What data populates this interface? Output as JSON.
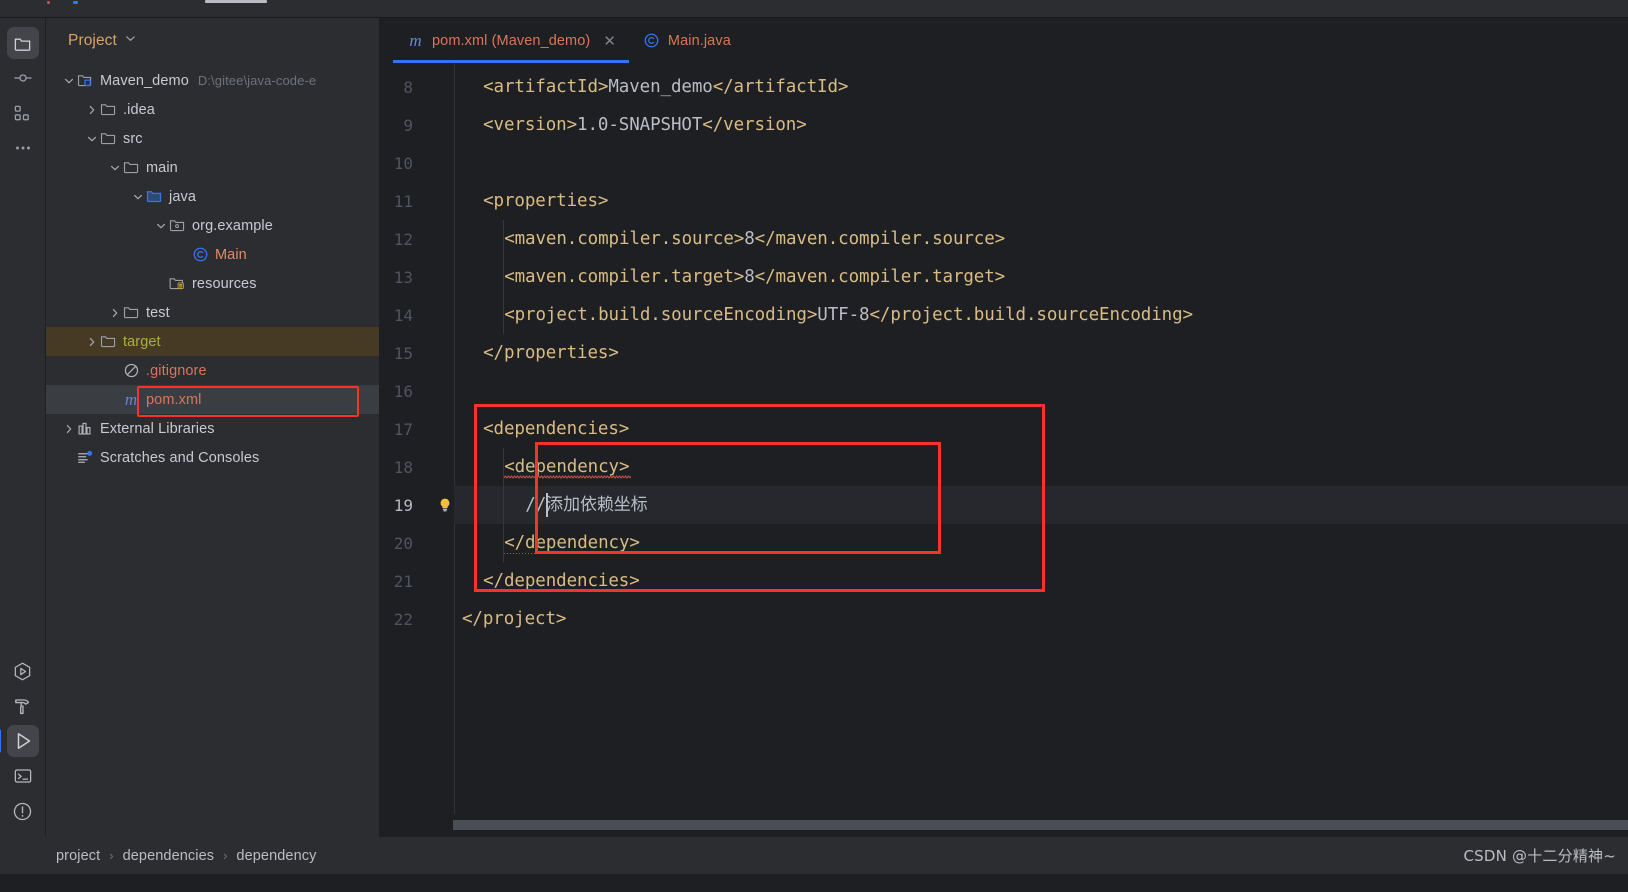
{
  "window": {
    "title_sliver": ""
  },
  "rail": {
    "top_items": [
      {
        "name": "project",
        "icon": "folder-icon",
        "selected": true
      },
      {
        "name": "commit",
        "icon": "commit-icon",
        "selected": false
      },
      {
        "name": "structure",
        "icon": "structure-icon",
        "selected": false
      },
      {
        "name": "more",
        "icon": "more-dots-icon",
        "selected": false
      }
    ],
    "bottom_items": [
      {
        "name": "run-with-coverage",
        "icon": "coverage-icon",
        "selected": false
      },
      {
        "name": "build",
        "icon": "hammer-icon",
        "selected": false
      },
      {
        "name": "run",
        "icon": "play-icon",
        "selected": true
      },
      {
        "name": "terminal",
        "icon": "terminal-icon",
        "selected": false
      },
      {
        "name": "problems",
        "icon": "warning-icon",
        "selected": false
      }
    ]
  },
  "project_panel": {
    "title": "Project",
    "dropdown_icon": "chevron-down-icon",
    "tree": [
      {
        "label": "Maven_demo",
        "sub": "D:\\gitee\\java-code-e",
        "icon": "module-folder-icon",
        "arrow": "expanded",
        "indent": 0,
        "style": "normal"
      },
      {
        "label": ".idea",
        "sub": "",
        "icon": "folder-icon",
        "arrow": "collapsed",
        "indent": 1,
        "style": "normal"
      },
      {
        "label": "src",
        "sub": "",
        "icon": "folder-icon",
        "arrow": "expanded",
        "indent": 1,
        "style": "normal"
      },
      {
        "label": "main",
        "sub": "",
        "icon": "folder-icon",
        "arrow": "expanded",
        "indent": 2,
        "style": "normal"
      },
      {
        "label": "java",
        "sub": "",
        "icon": "source-folder-icon",
        "arrow": "expanded",
        "indent": 3,
        "style": "normal"
      },
      {
        "label": "org.example",
        "sub": "",
        "icon": "package-icon",
        "arrow": "expanded",
        "indent": 4,
        "style": "normal"
      },
      {
        "label": "Main",
        "sub": "",
        "icon": "java-class-icon",
        "arrow": "none",
        "indent": 5,
        "style": "orange"
      },
      {
        "label": "resources",
        "sub": "",
        "icon": "resources-folder-icon",
        "arrow": "none",
        "indent": 4,
        "style": "normal"
      },
      {
        "label": "test",
        "sub": "",
        "icon": "folder-icon",
        "arrow": "collapsed",
        "indent": 2,
        "style": "normal"
      },
      {
        "label": "target",
        "sub": "",
        "icon": "folder-icon",
        "arrow": "collapsed",
        "indent": 1,
        "style": "olive",
        "row": "excluded-highlight"
      },
      {
        "label": ".gitignore",
        "sub": "",
        "icon": "gitignore-icon",
        "arrow": "none",
        "indent": 2,
        "style": "salmon"
      },
      {
        "label": "pom.xml",
        "sub": "",
        "icon": "maven-icon",
        "arrow": "none",
        "indent": 2,
        "style": "salmon",
        "row": "selected",
        "annotated": true
      },
      {
        "label": "External Libraries",
        "sub": "",
        "icon": "libraries-icon",
        "arrow": "collapsed",
        "indent": 0,
        "style": "normal"
      },
      {
        "label": "Scratches and Consoles",
        "sub": "",
        "icon": "scratches-icon",
        "arrow": "none",
        "indent": 0,
        "style": "normal"
      }
    ]
  },
  "tabs": [
    {
      "label": "pom.xml (Maven_demo)",
      "icon": "maven-icon",
      "active": true,
      "closable": true,
      "close_icon": "close-icon"
    },
    {
      "label": "Main.java",
      "icon": "java-class-icon",
      "active": false,
      "closable": false,
      "close_icon": ""
    }
  ],
  "editor": {
    "active_line": 19,
    "inspection_icon": "lightbulb-icon",
    "lines": [
      {
        "n": 8,
        "indent": 2,
        "html": "<span class=\"tag\">&lt;artifactId&gt;</span><span class=\"val\">Maven_demo</span><span class=\"tag\">&lt;/artifactId&gt;</span>"
      },
      {
        "n": 9,
        "indent": 2,
        "html": "<span class=\"tag\">&lt;version&gt;</span><span class=\"val\">1.0-SNAPSHOT</span><span class=\"tag\">&lt;/version&gt;</span>"
      },
      {
        "n": 10,
        "indent": 0,
        "html": ""
      },
      {
        "n": 11,
        "indent": 2,
        "html": "<span class=\"tag\">&lt;properties&gt;</span>"
      },
      {
        "n": 12,
        "indent": 4,
        "html": "<span class=\"tag\">&lt;maven.compiler.source&gt;</span><span class=\"val\">8</span><span class=\"tag\">&lt;/maven.compiler.source&gt;</span>"
      },
      {
        "n": 13,
        "indent": 4,
        "html": "<span class=\"tag\">&lt;maven.compiler.target&gt;</span><span class=\"val\">8</span><span class=\"tag\">&lt;/maven.compiler.target&gt;</span>"
      },
      {
        "n": 14,
        "indent": 4,
        "html": "<span class=\"tag\">&lt;project.build.sourceEncoding&gt;</span><span class=\"val\">UTF-8</span><span class=\"tag\">&lt;/project.build.sourceEncoding&gt;</span>"
      },
      {
        "n": 15,
        "indent": 2,
        "html": "<span class=\"tag\">&lt;/properties&gt;</span>"
      },
      {
        "n": 16,
        "indent": 0,
        "html": ""
      },
      {
        "n": 17,
        "indent": 2,
        "html": "<span class=\"tag\">&lt;dependencies&gt;</span>"
      },
      {
        "n": 18,
        "indent": 4,
        "html": "<span class=\"tag\">&lt;dependency&gt;</span>"
      },
      {
        "n": 19,
        "indent": 6,
        "html": "<span class=\"cmt\">//</span><span class=\"cjk\">添加依赖坐标</span>"
      },
      {
        "n": 20,
        "indent": 4,
        "html": "<span class=\"tag\">&lt;/dependency&gt;</span>"
      },
      {
        "n": 21,
        "indent": 2,
        "html": "<span class=\"tag\">&lt;/dependencies&gt;</span>"
      },
      {
        "n": 22,
        "indent": 0,
        "html": "<span class=\"tag\">&lt;/project&gt;</span>"
      }
    ],
    "plain_text": {
      "8": "<artifactId>Maven_demo</artifactId>",
      "9": "<version>1.0-SNAPSHOT</version>",
      "11": "<properties>",
      "12": "<maven.compiler.source>8</maven.compiler.source>",
      "13": "<maven.compiler.target>8</maven.compiler.target>",
      "14": "<project.build.sourceEncoding>UTF-8</project.build.sourceEncoding>",
      "15": "</properties>",
      "17": "<dependencies>",
      "18": "<dependency>",
      "19": "//添加依赖坐标",
      "20": "</dependency>",
      "21": "</dependencies>",
      "22": "</project>"
    }
  },
  "annotations": {
    "color": "#f4322e",
    "boxes": [
      "pom-xml-tree-item",
      "dependencies-block",
      "dependency-block"
    ]
  },
  "breadcrumb": {
    "items": [
      "project",
      "dependencies",
      "dependency"
    ],
    "separator": "›"
  },
  "watermark": {
    "text": "CSDN @十二分精神~"
  },
  "colors": {
    "accent": "#3574f0",
    "panel_bg": "#2b2d30",
    "editor_bg": "#1e1f22",
    "tag": "#d9bb84",
    "value": "#b9bdc4",
    "file_orange": "#d9755a",
    "excluded_olive": "#a8b13e",
    "annotation_red": "#f4322e"
  }
}
